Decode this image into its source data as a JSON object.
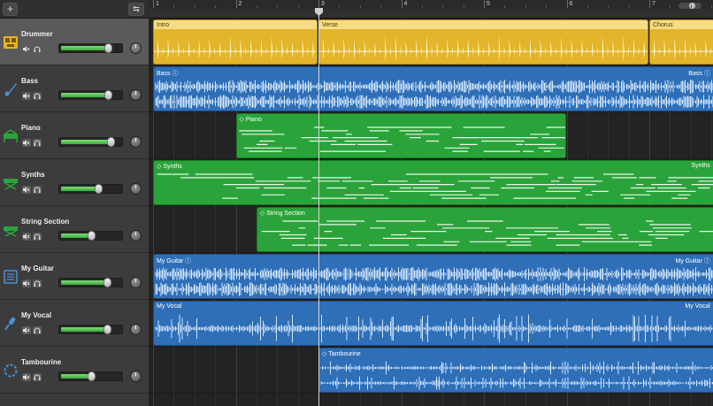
{
  "toolbar": {
    "add_label": "+",
    "catch_label": "⇆"
  },
  "ruler": {
    "bars": [
      "1",
      "2",
      "3",
      "4",
      "5",
      "6",
      "7"
    ]
  },
  "colors": {
    "drums": "#e3b52a",
    "audio": "#2e6fb8",
    "midi": "#2aa33a",
    "volume": "#39a839"
  },
  "tracks": [
    {
      "name": "Drummer",
      "icon": "drum-kit-icon",
      "volume": 0.78,
      "selected": true
    },
    {
      "name": "Bass",
      "icon": "bass-guitar-icon",
      "volume": 0.78
    },
    {
      "name": "Piano",
      "icon": "piano-icon",
      "volume": 0.82
    },
    {
      "name": "Synths",
      "icon": "synth-keyboard-icon",
      "volume": 0.62
    },
    {
      "name": "String Section",
      "icon": "string-keyboard-icon",
      "volume": 0.5
    },
    {
      "name": "My Guitar",
      "icon": "amp-icon",
      "volume": 0.77
    },
    {
      "name": "My Vocal",
      "icon": "microphone-icon",
      "volume": 0.77
    },
    {
      "name": "Tambourine",
      "icon": "tambourine-icon",
      "volume": 0.5
    }
  ],
  "regions": [
    {
      "track": 0,
      "label": "Intro",
      "label_right": "",
      "start": 1,
      "end": 3,
      "kind": "yellow"
    },
    {
      "track": 0,
      "label": "Verse",
      "label_right": "",
      "start": 3,
      "end": 7,
      "kind": "yellow"
    },
    {
      "track": 0,
      "label": "Chorus",
      "label_right": "",
      "start": 7,
      "end": 7.8,
      "kind": "yellow"
    },
    {
      "track": 1,
      "label": "Bass ⓘ",
      "label_right": "Bass ⓘ",
      "start": 1,
      "end": 7.8,
      "kind": "blue"
    },
    {
      "track": 2,
      "label": "◇ Piano",
      "label_right": "",
      "start": 2,
      "end": 6,
      "kind": "green"
    },
    {
      "track": 3,
      "label": "◇ Synths",
      "label_right": "Synths",
      "start": 1,
      "end": 7.8,
      "kind": "green"
    },
    {
      "track": 4,
      "label": "◇ String Section",
      "label_right": "",
      "start": 2.25,
      "end": 7.8,
      "kind": "green"
    },
    {
      "track": 5,
      "label": "My Guitar ⓘ",
      "label_right": "My Guitar ⓘ",
      "start": 1,
      "end": 7.8,
      "kind": "blue"
    },
    {
      "track": 6,
      "label": "My Vocal",
      "label_right": "My Vocal",
      "start": 1,
      "end": 7.8,
      "kind": "blue"
    },
    {
      "track": 7,
      "label": "◇ Tambourine",
      "label_right": "",
      "start": 3,
      "end": 7.8,
      "kind": "blue"
    }
  ],
  "playhead": {
    "bar": 3
  }
}
